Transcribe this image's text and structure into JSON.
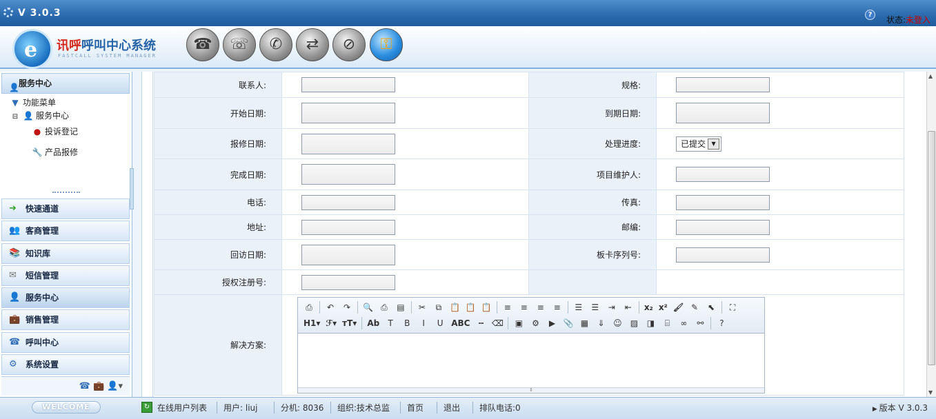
{
  "app": {
    "version": "V 3.0.3",
    "status_label": "状态:",
    "status_value": "未登入",
    "brand_red": "讯呼",
    "brand_blue": "呼叫中心系统",
    "brand_sub": "FASTCALL SYSTEM MANAGER"
  },
  "sidebar": {
    "header": "服务中心",
    "tree": {
      "root": "功能菜单",
      "group": "服务中心",
      "items": [
        {
          "label": "投诉登记"
        },
        {
          "label": "产品报修"
        }
      ]
    },
    "menu": [
      {
        "label": "快速通道",
        "icon": "arrow-right-icon"
      },
      {
        "label": "客商管理",
        "icon": "users-icon"
      },
      {
        "label": "知识库",
        "icon": "books-icon"
      },
      {
        "label": "短信管理",
        "icon": "envelope-icon"
      },
      {
        "label": "服务中心",
        "icon": "person-icon"
      },
      {
        "label": "销售管理",
        "icon": "briefcase-icon"
      },
      {
        "label": "呼叫中心",
        "icon": "phone-icon"
      },
      {
        "label": "系统设置",
        "icon": "settings-icon"
      }
    ]
  },
  "form": {
    "contact_label": "联系人:",
    "spec_label": "规格:",
    "start_date_label": "开始日期:",
    "end_date_label": "到期日期:",
    "repair_date_label": "报修日期:",
    "progress_label": "处理进度:",
    "progress_value": "已提交",
    "finish_date_label": "完成日期:",
    "maintainer_label": "项目维护人:",
    "phone_label": "电话:",
    "fax_label": "传真:",
    "address_label": "地址:",
    "zip_label": "邮编:",
    "visit_date_label": "回访日期:",
    "card_serial_label": "板卡序列号:",
    "license_label": "授权注册号:",
    "solution_label": "解决方案:"
  },
  "editor": {
    "row1": [
      {
        "icon": "source-icon",
        "glyph": "⎙"
      },
      {
        "icon": "undo-icon",
        "glyph": "↶"
      },
      {
        "icon": "redo-icon",
        "glyph": "↷"
      },
      {
        "icon": "preview-icon",
        "glyph": "🔍"
      },
      {
        "icon": "print-icon",
        "glyph": "⎙"
      },
      {
        "icon": "template-icon",
        "glyph": "▤"
      },
      {
        "icon": "cut-icon",
        "glyph": "✂"
      },
      {
        "icon": "copy-icon",
        "glyph": "⧉"
      },
      {
        "icon": "paste-icon",
        "glyph": "📋"
      },
      {
        "icon": "paste-text-icon",
        "glyph": "📋"
      },
      {
        "icon": "paste-word-icon",
        "glyph": "📋"
      },
      {
        "icon": "align-left-icon",
        "glyph": "≡"
      },
      {
        "icon": "align-center-icon",
        "glyph": "≡"
      },
      {
        "icon": "align-right-icon",
        "glyph": "≡"
      },
      {
        "icon": "align-justify-icon",
        "glyph": "≡"
      },
      {
        "icon": "ordered-list-icon",
        "glyph": "☰"
      },
      {
        "icon": "unordered-list-icon",
        "glyph": "☰"
      },
      {
        "icon": "indent-icon",
        "glyph": "⇥"
      },
      {
        "icon": "outdent-icon",
        "glyph": "⇤"
      },
      {
        "icon": "subscript-icon",
        "glyph": "x₂"
      },
      {
        "icon": "superscript-icon",
        "glyph": "x²"
      },
      {
        "icon": "clear-format-icon",
        "glyph": "🖌"
      },
      {
        "icon": "quick-format-icon",
        "glyph": "✎"
      },
      {
        "icon": "select-all-icon",
        "glyph": "⬉"
      },
      {
        "icon": "fullscreen-icon",
        "glyph": "⛶"
      }
    ],
    "row2": [
      {
        "icon": "heading-icon",
        "glyph": "H1▾"
      },
      {
        "icon": "font-family-icon",
        "glyph": "ℱ▾"
      },
      {
        "icon": "font-size-icon",
        "glyph": "тT▾"
      },
      {
        "icon": "font-color-icon",
        "glyph": "Ab"
      },
      {
        "icon": "highlight-icon",
        "glyph": "T"
      },
      {
        "icon": "bold-icon",
        "glyph": "B"
      },
      {
        "icon": "italic-icon",
        "glyph": "I"
      },
      {
        "icon": "underline-icon",
        "glyph": "U"
      },
      {
        "icon": "strikethrough-icon",
        "glyph": "ABC"
      },
      {
        "icon": "horizontal-rule-icon",
        "glyph": "┅"
      },
      {
        "icon": "eraser-icon",
        "glyph": "⌫"
      },
      {
        "icon": "image-upload-icon",
        "glyph": "▣"
      },
      {
        "icon": "flash-icon",
        "glyph": "⚙"
      },
      {
        "icon": "media-icon",
        "glyph": "▶"
      },
      {
        "icon": "attachment-icon",
        "glyph": "📎"
      },
      {
        "icon": "table-icon",
        "glyph": "▦"
      },
      {
        "icon": "hr-insert-icon",
        "glyph": "⇓"
      },
      {
        "icon": "emoticon-icon",
        "glyph": "☺"
      },
      {
        "icon": "image-icon",
        "glyph": "▨"
      },
      {
        "icon": "code-icon",
        "glyph": "◨"
      },
      {
        "icon": "page-break-icon",
        "glyph": "⌸"
      },
      {
        "icon": "link-icon",
        "glyph": "∞"
      },
      {
        "icon": "unlink-icon",
        "glyph": "⚯"
      },
      {
        "icon": "about-icon",
        "glyph": "?"
      }
    ],
    "resize_glyph": "⇕"
  },
  "statusbar": {
    "welcome": "WELCOME",
    "online_list": "在线用户列表",
    "user": "用户: liuj",
    "extension": "分机: 8036",
    "org": "组织:技术总监",
    "home": "首页",
    "logout": "退出",
    "queue": "排队电话:0",
    "version": "版本 V 3.0.3"
  }
}
